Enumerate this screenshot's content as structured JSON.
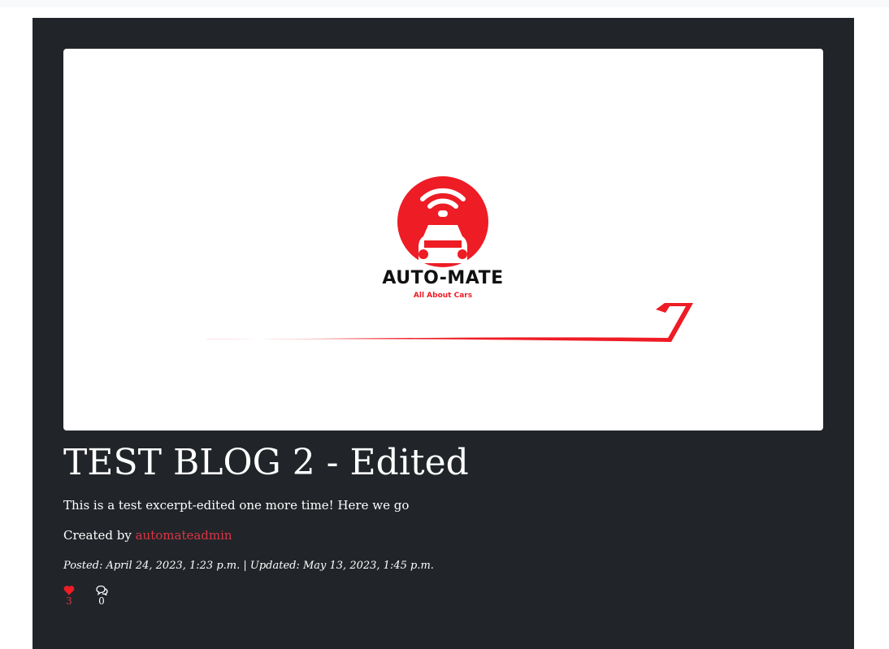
{
  "post": {
    "image_alt": "AUTO-MATE logo",
    "logo": {
      "wordmark": "AUTO-MATE",
      "tagline": "All About Cars"
    },
    "title": "TEST BLOG 2 - Edited",
    "excerpt": "This is a test excerpt-edited one more time! Here we go",
    "created_by_prefix": "Created by",
    "author": "automateadmin",
    "dates": "Posted: April 24, 2023, 1:23 p.m. | Updated: May 13, 2023, 1:45 p.m.",
    "likes": {
      "count": "3",
      "icon": "heart-icon"
    },
    "comments": {
      "count": "0",
      "icon": "comments-icon"
    }
  },
  "colors": {
    "card_bg": "#212529",
    "accent_red": "#dc3545",
    "logo_red": "#ee1c25"
  }
}
